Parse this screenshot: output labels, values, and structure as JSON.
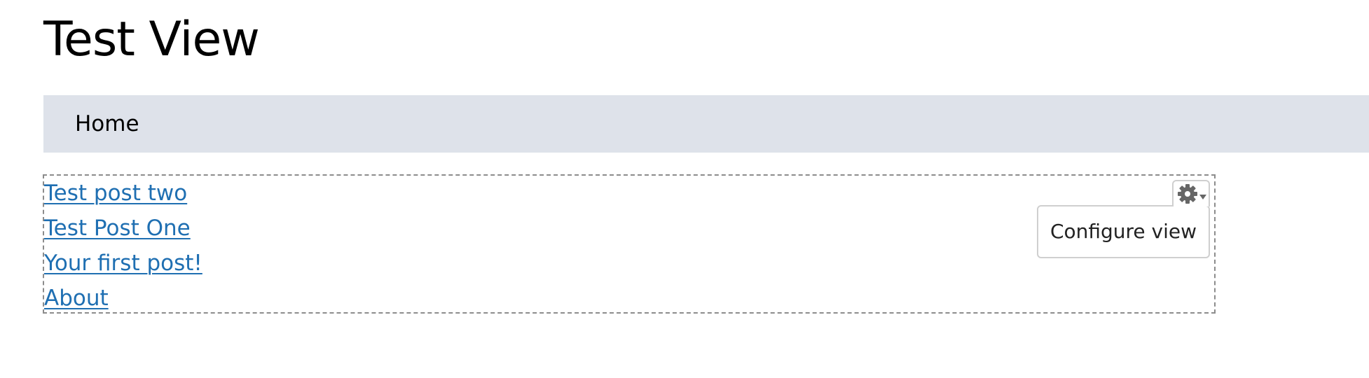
{
  "page": {
    "title": "Test View"
  },
  "nav": {
    "home_label": "Home"
  },
  "view": {
    "posts": [
      {
        "label": "Test post two"
      },
      {
        "label": "Test Post One"
      },
      {
        "label": "Your first post!"
      },
      {
        "label": "About"
      }
    ],
    "contextual_menu": {
      "trigger_icon": "gear-icon",
      "items": [
        {
          "label": "Configure view"
        }
      ]
    }
  },
  "colors": {
    "nav_background": "#dee2ea",
    "link": "#1f6fb2",
    "dashed_border": "#8c8c8c",
    "gear": "#666666"
  }
}
